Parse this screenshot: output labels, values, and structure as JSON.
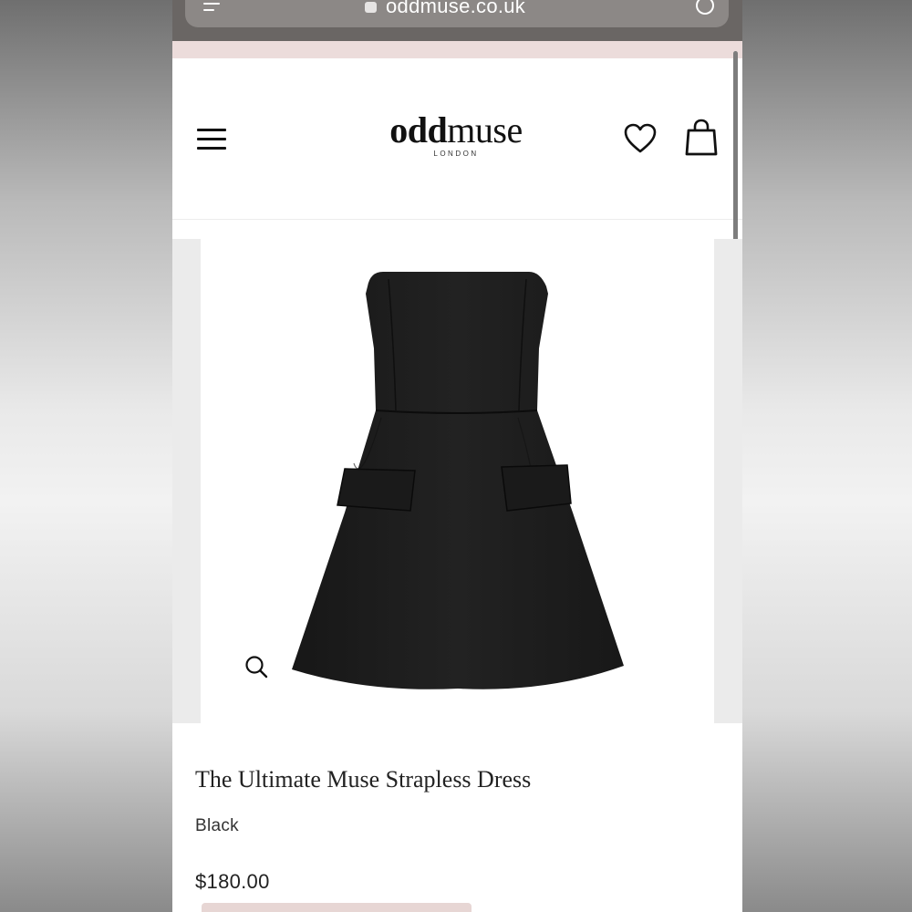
{
  "browser": {
    "url": "oddmuse.co.uk"
  },
  "header": {
    "logo_bold": "odd",
    "logo_light": "muse",
    "logo_sub": "LONDON"
  },
  "product": {
    "title": "The Ultimate Muse Strapless Dress",
    "color": "Black",
    "price": "$180.00"
  },
  "colors": {
    "accent_pink": "#ecdcdb",
    "dress": "#1c1c1c",
    "text": "#222222"
  },
  "icons": {
    "menu": "hamburger-icon",
    "wishlist": "heart-icon",
    "cart": "shopping-bag-icon",
    "zoom": "magnifier-icon",
    "reload": "reload-icon"
  }
}
